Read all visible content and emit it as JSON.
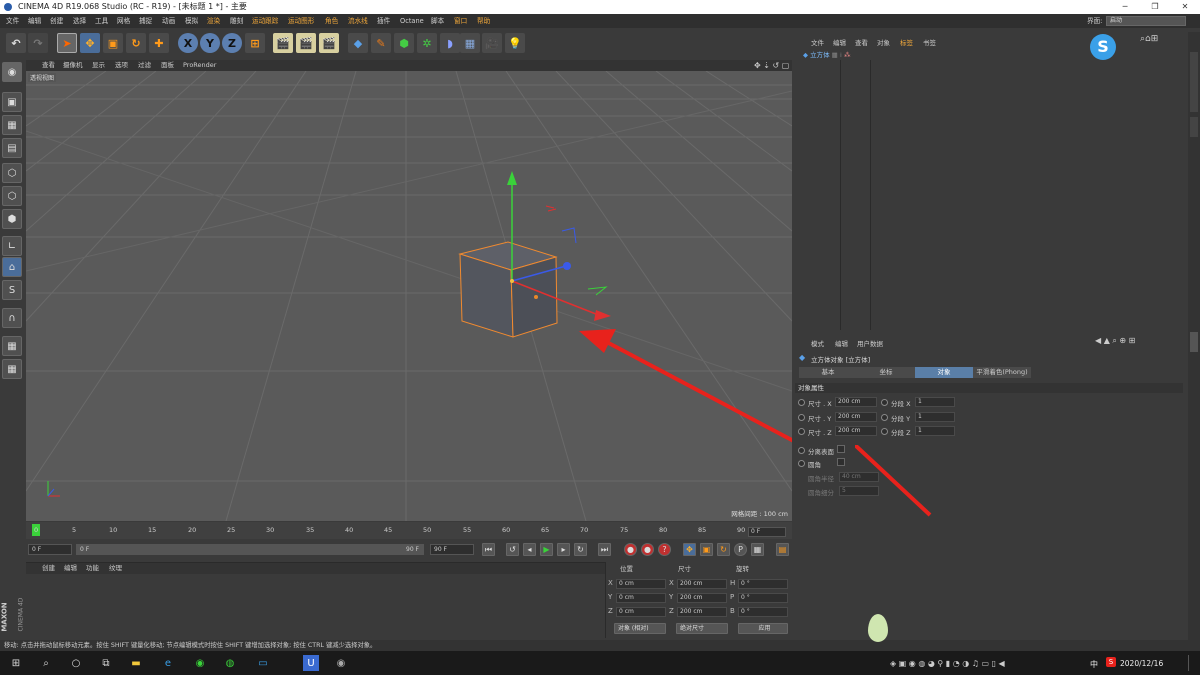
{
  "window": {
    "title": "CINEMA 4D R19.068 Studio (RC - R19) - [未标题 1 *] - 主要",
    "minimize": "─",
    "maximize": "❐",
    "close": "✕"
  },
  "menubar": {
    "items": [
      "文件",
      "编辑",
      "创建",
      "选择",
      "工具",
      "网格",
      "捕捉",
      "动画",
      "模拟",
      "渲染",
      "雕刻",
      "运动跟踪",
      "运动图形",
      "角色",
      "流水线",
      "插件",
      "Octane",
      "脚本",
      "窗口",
      "帮助"
    ],
    "layout_label": "界面:",
    "layout_value": "启动"
  },
  "viewport": {
    "menu": [
      "查看",
      "摄像机",
      "显示",
      "选项",
      "过滤",
      "面板",
      "ProRender"
    ],
    "view_name": "透视视图",
    "grid_spacing": "网格间距 : 100 cm"
  },
  "timeline": {
    "ticks": [
      "0",
      "5",
      "10",
      "15",
      "20",
      "25",
      "30",
      "35",
      "40",
      "45",
      "50",
      "55",
      "60",
      "65",
      "70",
      "75",
      "80",
      "85",
      "90"
    ],
    "current_frame": "0 F"
  },
  "transport": {
    "start": "0 F",
    "range_start": "0 F",
    "range_end": "90 F",
    "end": "90 F"
  },
  "materials": {
    "tabs": [
      "创建",
      "编辑",
      "功能",
      "纹理"
    ]
  },
  "coords": {
    "headers": [
      "位置",
      "尺寸",
      "旋转"
    ],
    "rows": [
      {
        "axis": "X",
        "pos": "0 cm",
        "size_axis": "X",
        "size": "200 cm",
        "rot_axis": "H",
        "rot": "0 °"
      },
      {
        "axis": "Y",
        "pos": "0 cm",
        "size_axis": "Y",
        "size": "200 cm",
        "rot_axis": "P",
        "rot": "0 °"
      },
      {
        "axis": "Z",
        "pos": "0 cm",
        "size_axis": "Z",
        "size": "200 cm",
        "rot_axis": "B",
        "rot": "0 °"
      }
    ],
    "mode": "对象 (相对)",
    "size_mode": "绝对尺寸",
    "apply": "应用"
  },
  "objects": {
    "menu": [
      "文件",
      "编辑",
      "查看",
      "对象",
      "标签",
      "书签"
    ],
    "item": "立方体"
  },
  "attributes": {
    "menu": [
      "模式",
      "编辑",
      "用户数据"
    ],
    "object_title": "立方体对象 [立方体]",
    "tabs": [
      "基本",
      "坐标",
      "对象",
      "平滑着色(Phong)"
    ],
    "section": "对象属性",
    "rows": [
      {
        "label": "尺寸 . X",
        "value": "200 cm",
        "seg_label": "分段 X",
        "seg": "1"
      },
      {
        "label": "尺寸 . Y",
        "value": "200 cm",
        "seg_label": "分段 Y",
        "seg": "1"
      },
      {
        "label": "尺寸 . Z",
        "value": "200 cm",
        "seg_label": "分段 Z",
        "seg": "1"
      }
    ],
    "separate": "分离表面",
    "fillet": "圆角",
    "fillet_radius_label": "圆角半径",
    "fillet_radius": "40 cm",
    "fillet_sub_label": "圆角细分",
    "fillet_sub": "5"
  },
  "statusbar": {
    "text": "移动: 点击并拖动鼠标移动元素。按住 SHIFT 键量化移动; 节点编辑模式时按住 SHIFT 键增加选择对象; 按住 CTRL 键减少选择对象。"
  },
  "brand": {
    "maxon": "MAXON",
    "c4d": "CINEMA 4D"
  },
  "taskbar": {
    "date": "2020/12/16",
    "ime": "中",
    "s_label": "S"
  },
  "colors": {
    "accent": "#f2a93b",
    "selection": "#5a7fa8",
    "arrow": "#e8221c"
  }
}
